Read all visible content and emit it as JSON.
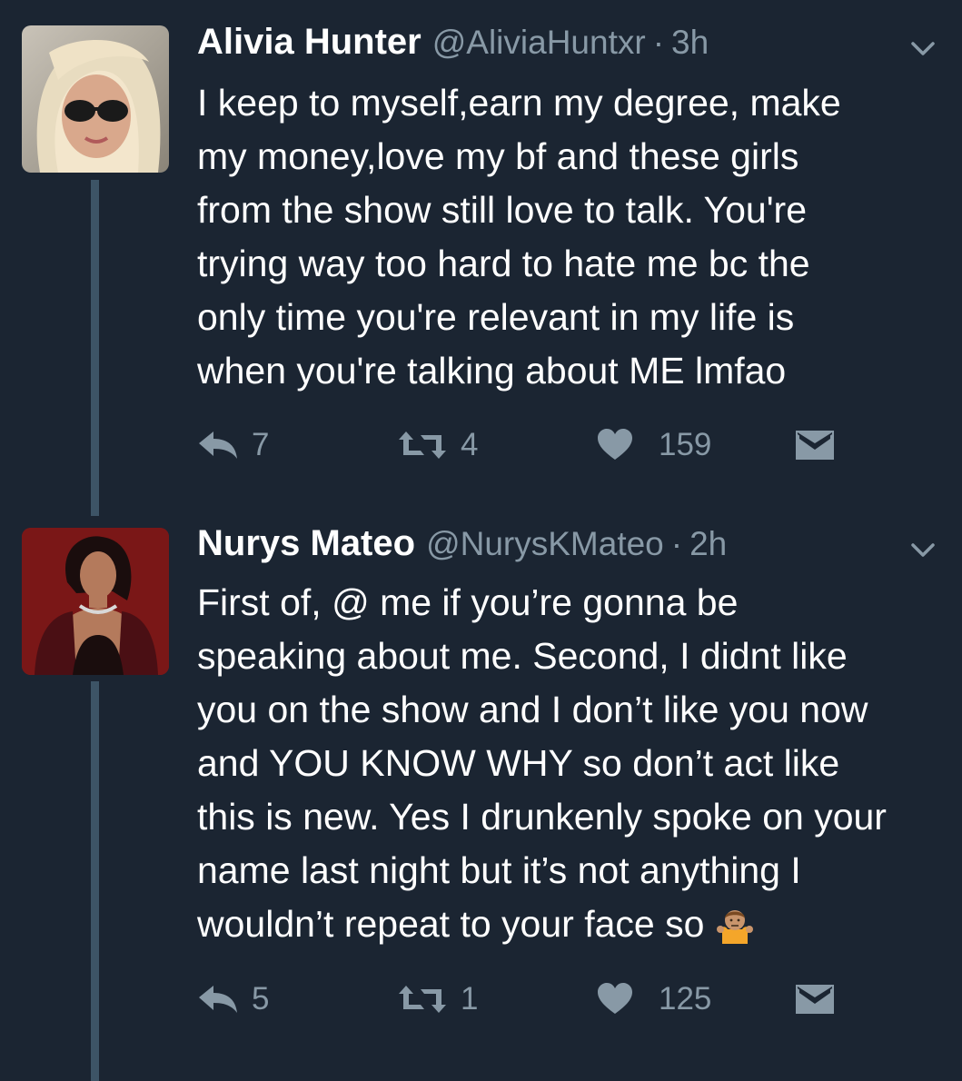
{
  "colors": {
    "background": "#1b2532",
    "text": "#ffffff",
    "muted": "#8899a6",
    "thread_line": "#3d5466"
  },
  "tweets": [
    {
      "name": "Alivia Hunter",
      "handle": "@AliviaHuntxr",
      "separator": "·",
      "time": "3h",
      "lines": [
        "I keep to myself,earn my degree, make",
        "my money,love my bf and these girls",
        "from the show still love to talk. You're",
        "trying way too hard to hate me bc the",
        "only time you're relevant in my life is",
        "when you're talking about ME lmfao"
      ],
      "replies": "7",
      "retweets": "4",
      "likes": "159"
    },
    {
      "name": "Nurys Mateo",
      "handle": "@NurysKMateo",
      "separator": "·",
      "time": "2h",
      "lines": [
        "First of, @ me if you’re gonna be",
        "speaking about me. Second, I didnt like",
        "you on the show and I don’t like you now",
        "and YOU KNOW WHY so don’t act like",
        "this is new. Yes I drunkenly spoke on your",
        "name last night but it’s not anything I",
        "wouldn’t repeat to your face so"
      ],
      "emoji": "person-shrugging-emoji",
      "replies": "5",
      "retweets": "1",
      "likes": "125"
    }
  ]
}
